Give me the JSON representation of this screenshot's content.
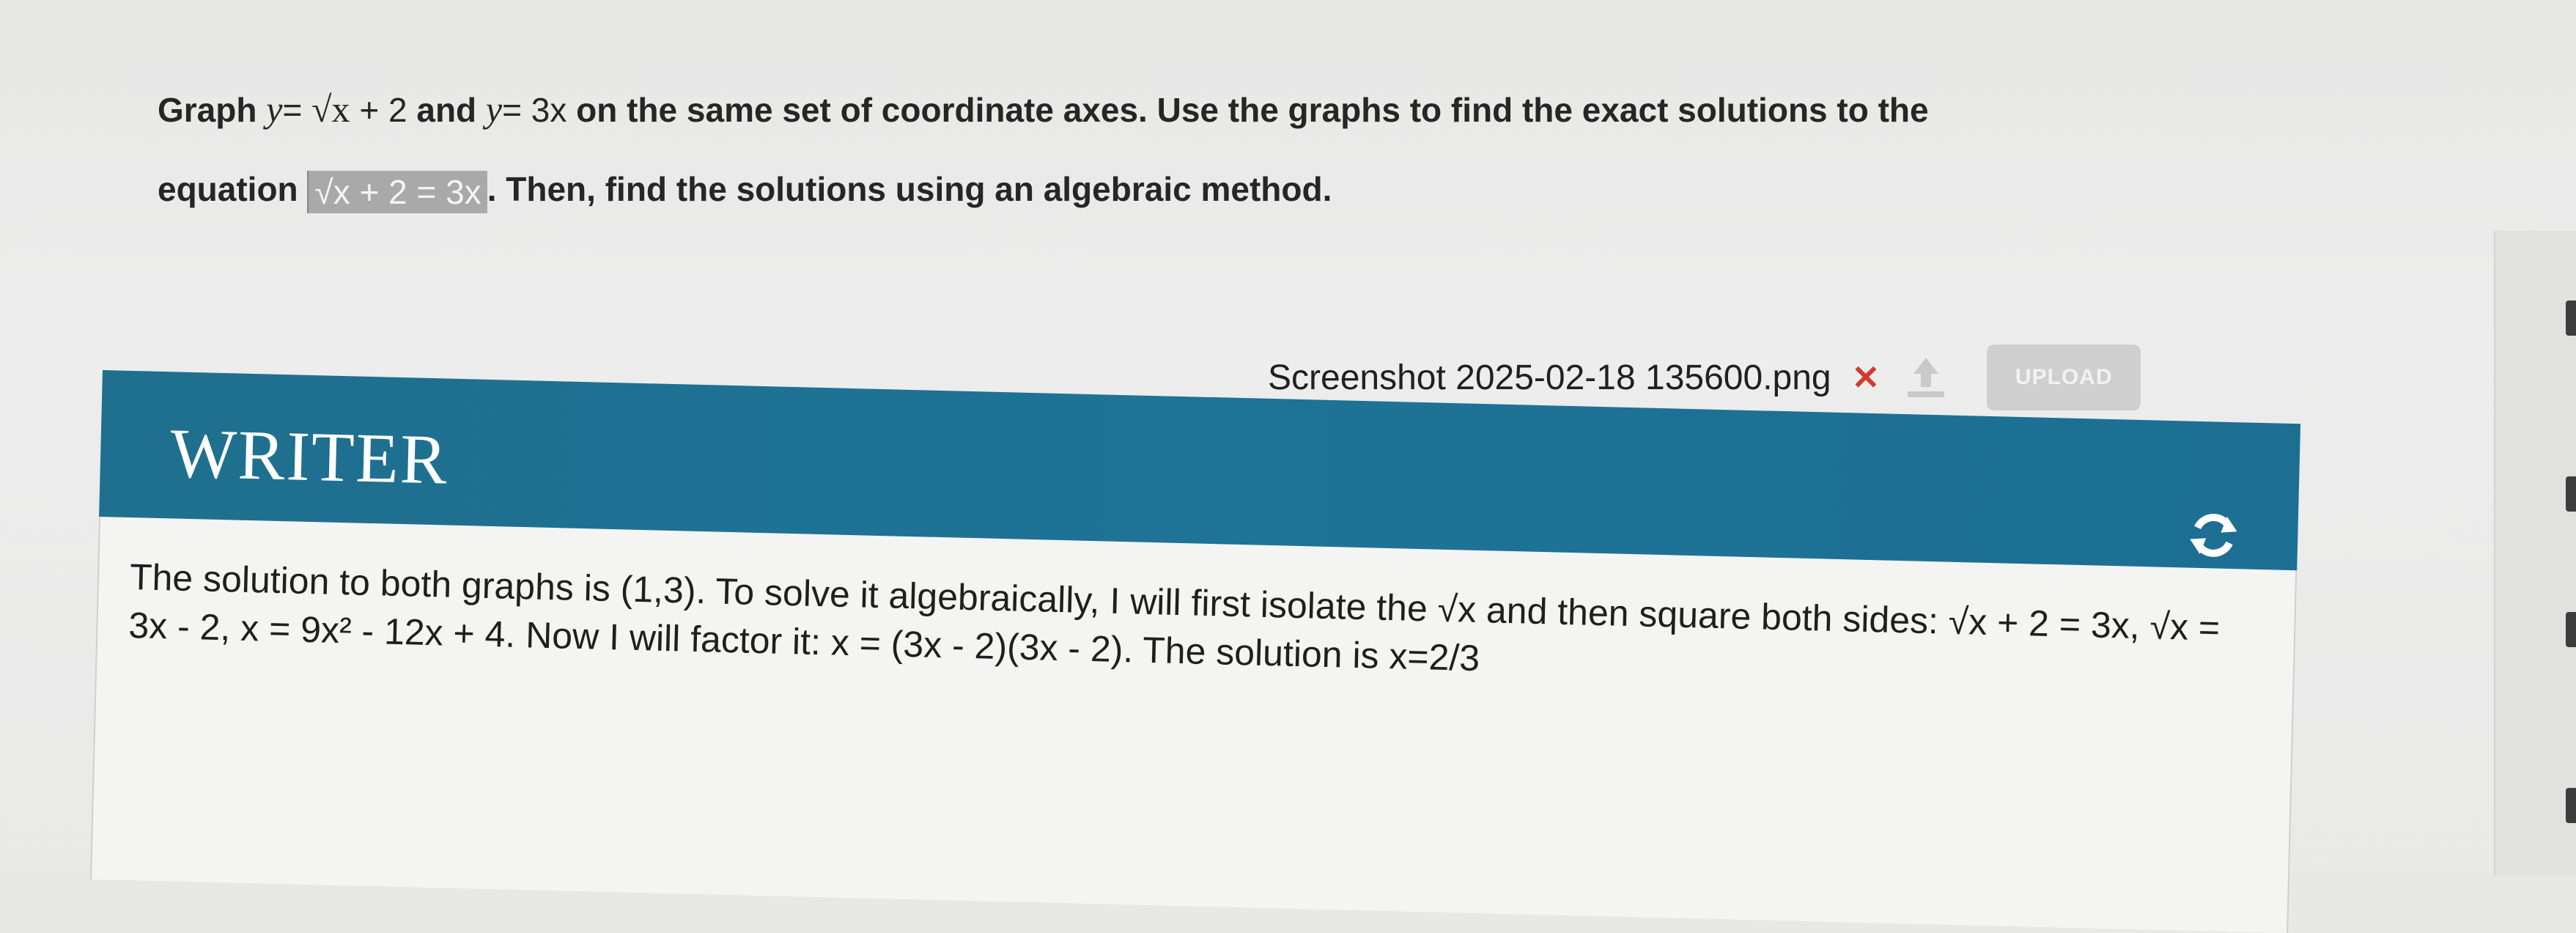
{
  "question": {
    "line1": {
      "graph": "Graph ",
      "y1": "y",
      "eq1": "= ",
      "sqrt_x": "√x",
      "plus2": " + 2",
      "and": " and ",
      "y2": "y",
      "eq2": "= 3x",
      "rest": " on the same set of coordinate axes. Use the graphs to find the exact solutions to the"
    },
    "line2": {
      "equation": "equation ",
      "box_sqrt": "√x",
      "box_expr": " + 2 = 3x",
      "rest": ". Then, find the solutions using an algebraic method."
    }
  },
  "upload": {
    "filename": "Screenshot 2025-02-18 135600.png",
    "remove_symbol": "✕",
    "button_label": "UPLOAD"
  },
  "writer": {
    "title": "WRITER",
    "answer_text": "The solution to both graphs is (1,3). To solve it algebraically, I will first isolate the √x and then square both sides: √x + 2 = 3x, √x = 3x - 2, x = 9x² - 12x + 4. Now I will factor it: x = (3x - 2)(3x - 2). The solution is x=2/3"
  },
  "colors": {
    "header_blue": "#1e7396",
    "remove_red": "#d23a2f",
    "upload_button_gray": "#cfcfcf"
  },
  "icons": [
    "close-icon",
    "upload-arrow-icon",
    "refresh-icon"
  ]
}
